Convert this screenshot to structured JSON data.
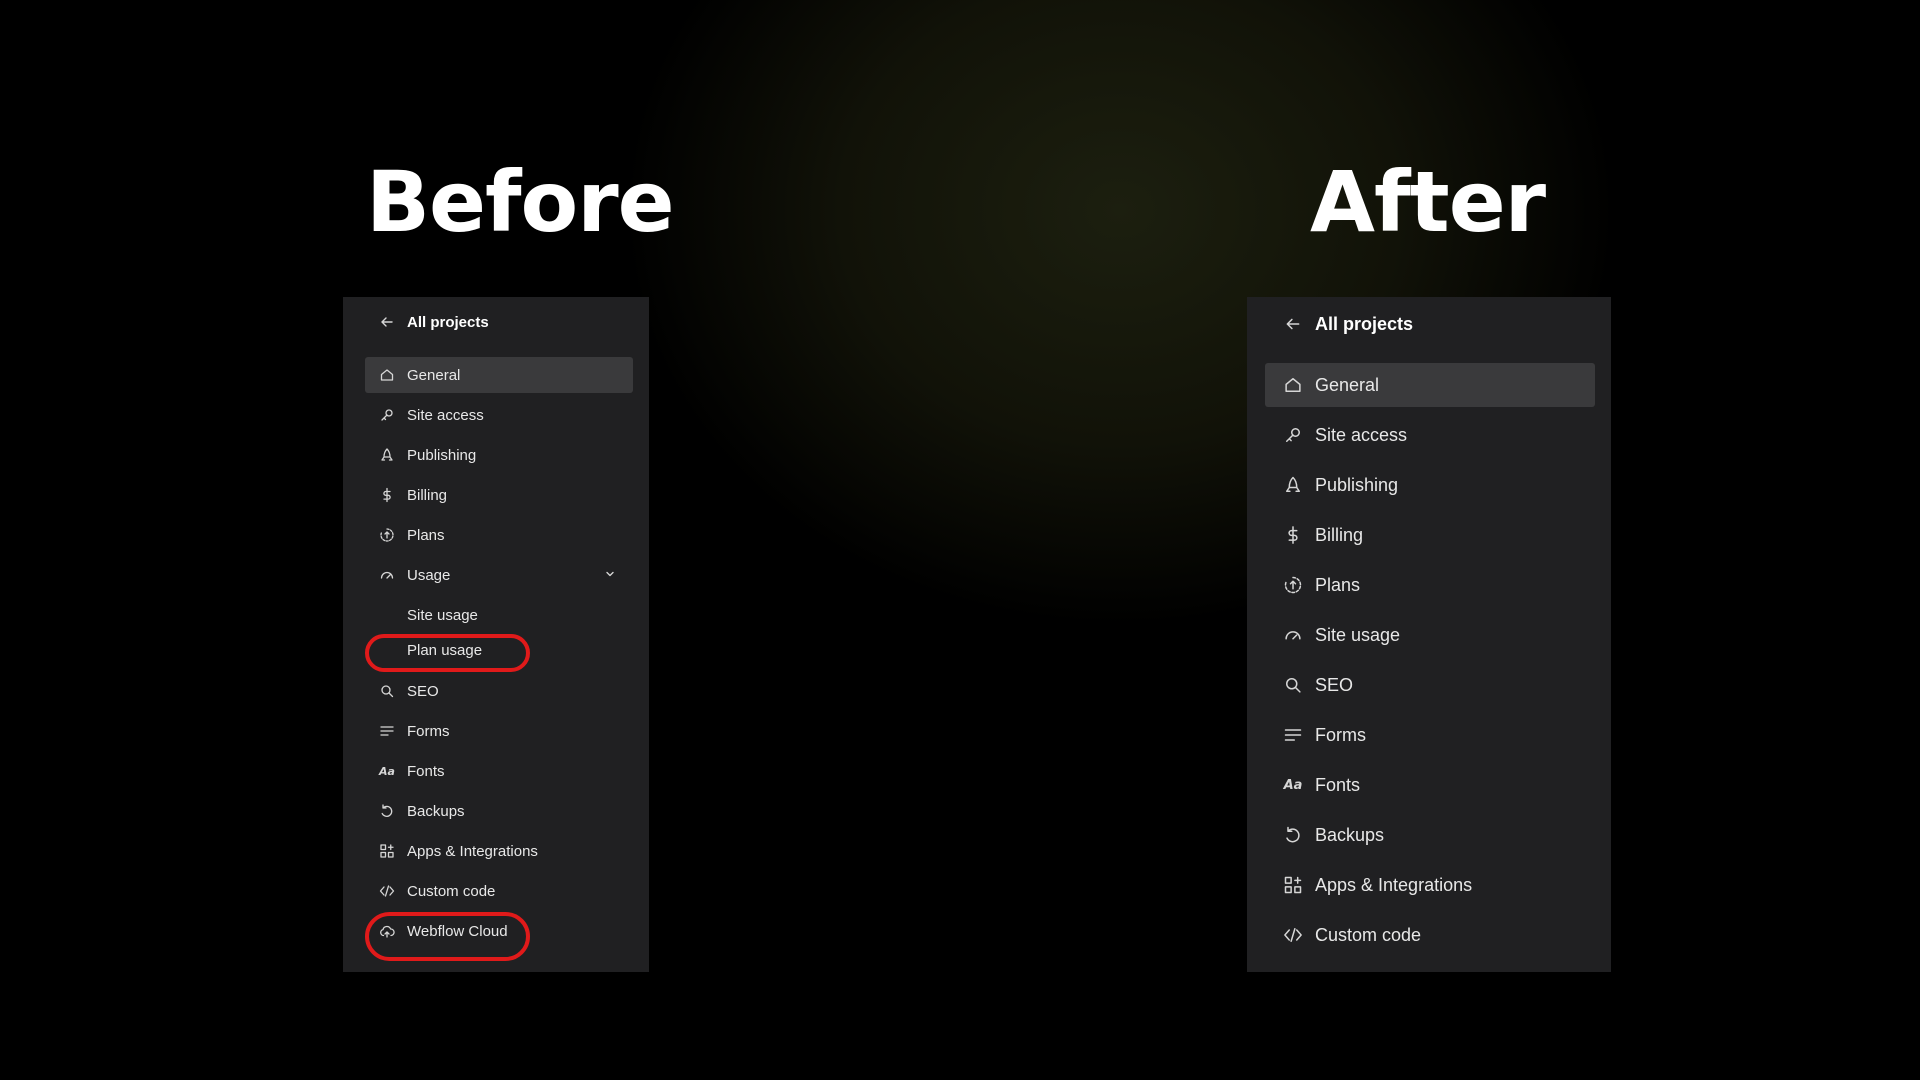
{
  "headings": {
    "before": "Before",
    "after": "After"
  },
  "before": {
    "back_label": "All projects",
    "items": [
      {
        "label": "General",
        "icon": "home-icon"
      },
      {
        "label": "Site access",
        "icon": "key-icon"
      },
      {
        "label": "Publishing",
        "icon": "rocket-icon"
      },
      {
        "label": "Billing",
        "icon": "dollar-icon"
      },
      {
        "label": "Plans",
        "icon": "plans-icon"
      },
      {
        "label": "Usage",
        "icon": "gauge-icon"
      },
      {
        "label": "Site usage"
      },
      {
        "label": "Plan usage"
      },
      {
        "label": "SEO",
        "icon": "search-icon"
      },
      {
        "label": "Forms",
        "icon": "forms-icon"
      },
      {
        "label": "Fonts",
        "icon": "fonts-icon",
        "glyph": "Aa"
      },
      {
        "label": "Backups",
        "icon": "backup-icon"
      },
      {
        "label": "Apps & Integrations",
        "icon": "apps-icon"
      },
      {
        "label": "Custom code",
        "icon": "code-icon"
      },
      {
        "label": "Webflow Cloud",
        "icon": "cloud-icon"
      }
    ]
  },
  "after": {
    "back_label": "All projects",
    "items": [
      {
        "label": "General",
        "icon": "home-icon"
      },
      {
        "label": "Site access",
        "icon": "key-icon"
      },
      {
        "label": "Publishing",
        "icon": "rocket-icon"
      },
      {
        "label": "Billing",
        "icon": "dollar-icon"
      },
      {
        "label": "Plans",
        "icon": "plans-icon"
      },
      {
        "label": "Site usage",
        "icon": "gauge-icon"
      },
      {
        "label": "SEO",
        "icon": "search-icon"
      },
      {
        "label": "Forms",
        "icon": "forms-icon"
      },
      {
        "label": "Fonts",
        "icon": "fonts-icon",
        "glyph": "Aa"
      },
      {
        "label": "Backups",
        "icon": "backup-icon"
      },
      {
        "label": "Apps & Integrations",
        "icon": "apps-icon"
      },
      {
        "label": "Custom code",
        "icon": "code-icon"
      }
    ]
  },
  "colors": {
    "highlight_circle": "#e01a1a",
    "panel": "#202022",
    "active_row": "#3a3a3c"
  }
}
